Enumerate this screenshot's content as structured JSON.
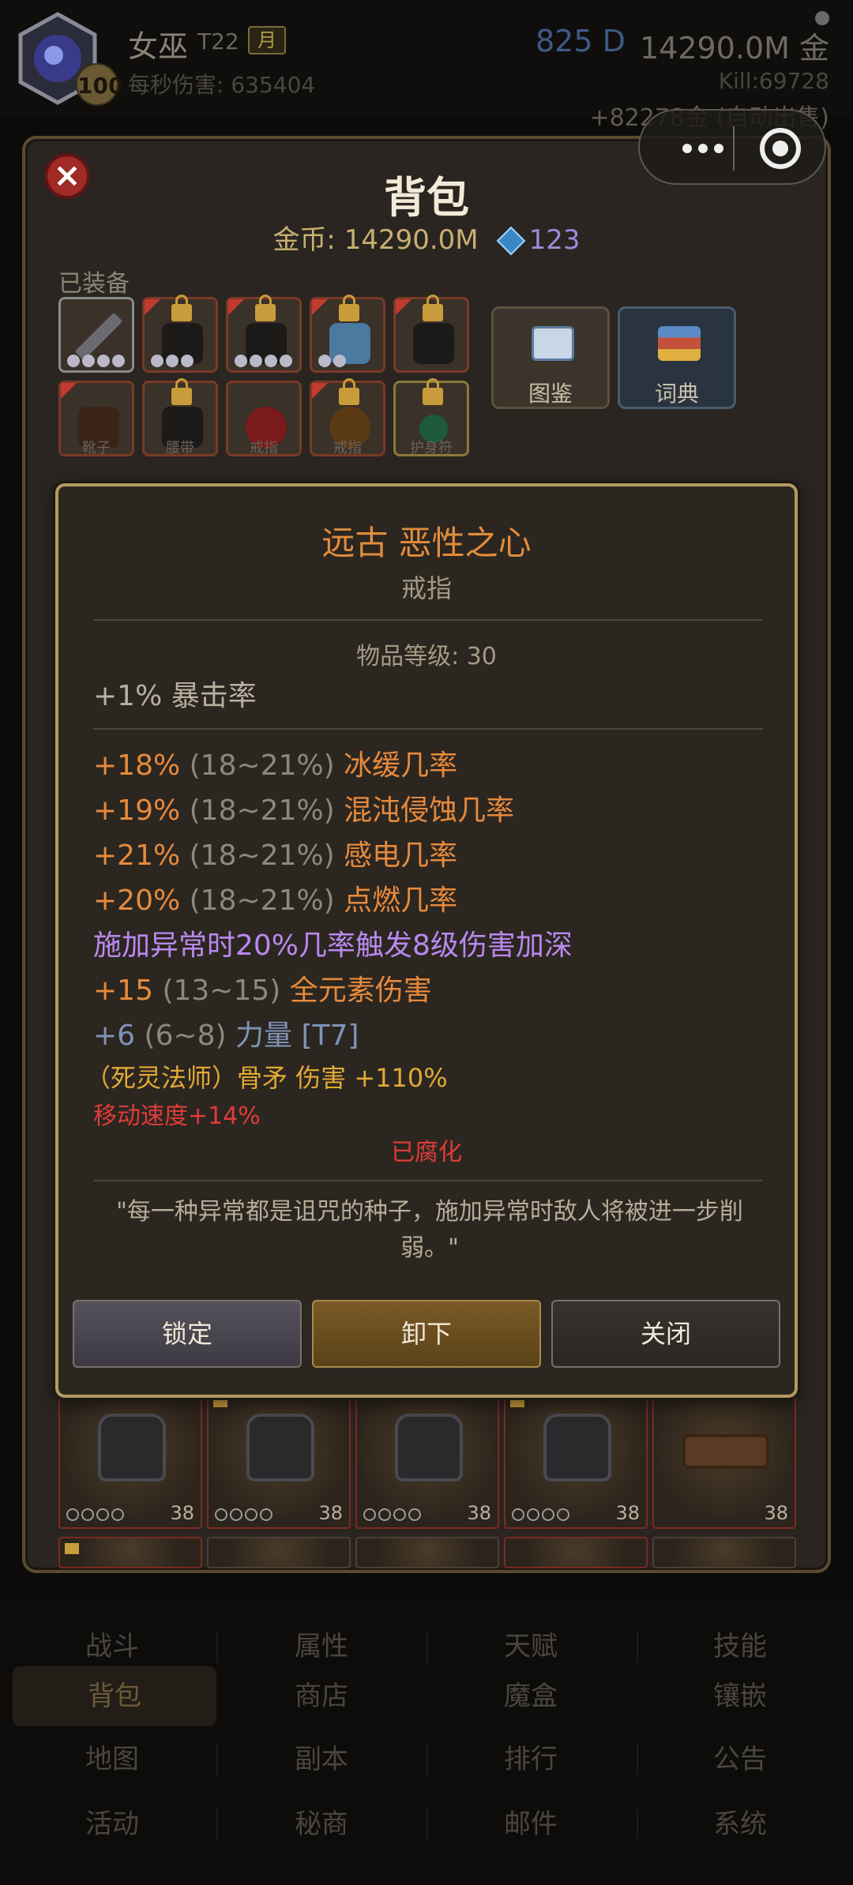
{
  "header": {
    "avatar_level": "100",
    "char_name": "女巫",
    "tier": "T22",
    "month_badge": "月",
    "dps": "每秒伤害: 635404",
    "diamonds": "825 D",
    "gold": "14290.0M 金",
    "kill": "Kill:69728",
    "gold_gain": "+82278金 (自动出售)"
  },
  "bag": {
    "title": "背包",
    "gold_label": "金币: 14290.0M",
    "gem_value": "123",
    "equipped_label": "已装备",
    "slot_labels": [
      "靴子",
      "腰带",
      "戒指",
      "戒指",
      "护身符"
    ],
    "side_buttons": [
      "图鉴",
      "词典"
    ],
    "inventory_levels": [
      "38",
      "38",
      "38",
      "38",
      "38"
    ]
  },
  "item": {
    "name": "远古 恶性之心",
    "type": "戒指",
    "item_level": "物品等级: 30",
    "implicit": "+1% 暴击率",
    "affixes": [
      {
        "value": "+18%",
        "range": "(18~21%)",
        "stat": "冰缓几率"
      },
      {
        "value": "+19%",
        "range": "(18~21%)",
        "stat": "混沌侵蚀几率"
      },
      {
        "value": "+21%",
        "range": "(18~21%)",
        "stat": "感电几率"
      },
      {
        "value": "+20%",
        "range": "(18~21%)",
        "stat": "点燃几率"
      }
    ],
    "special": "施加异常时20%几率触发8级伤害加深",
    "elemental": {
      "value": "+15",
      "range": "(13~15)",
      "stat": "全元素伤害"
    },
    "strength": {
      "value": "+6",
      "range": "(6~8)",
      "stat": "力量 [T7]"
    },
    "class_bonus": "（死灵法师）骨矛 伤害 +110%",
    "move_speed": "移动速度+14%",
    "corrupted": "已腐化",
    "quote": "\"每一种异常都是诅咒的种子，施加异常时敌人将被进一步削弱。\"",
    "buttons": {
      "lock": "锁定",
      "unequip": "卸下",
      "close": "关闭"
    }
  },
  "nav": [
    [
      "战斗",
      "属性",
      "天赋",
      "技能"
    ],
    [
      "背包",
      "商店",
      "魔盒",
      "镶嵌"
    ],
    [
      "地图",
      "副本",
      "排行",
      "公告"
    ],
    [
      "活动",
      "秘商",
      "邮件",
      "系统"
    ]
  ],
  "colors": {
    "legendary_orange": "#e68a3c",
    "special_purple": "#b989f0",
    "corrupted_red": "#e03c38",
    "class_yellow": "#e1aa34",
    "frame_gold": "#b49860"
  }
}
